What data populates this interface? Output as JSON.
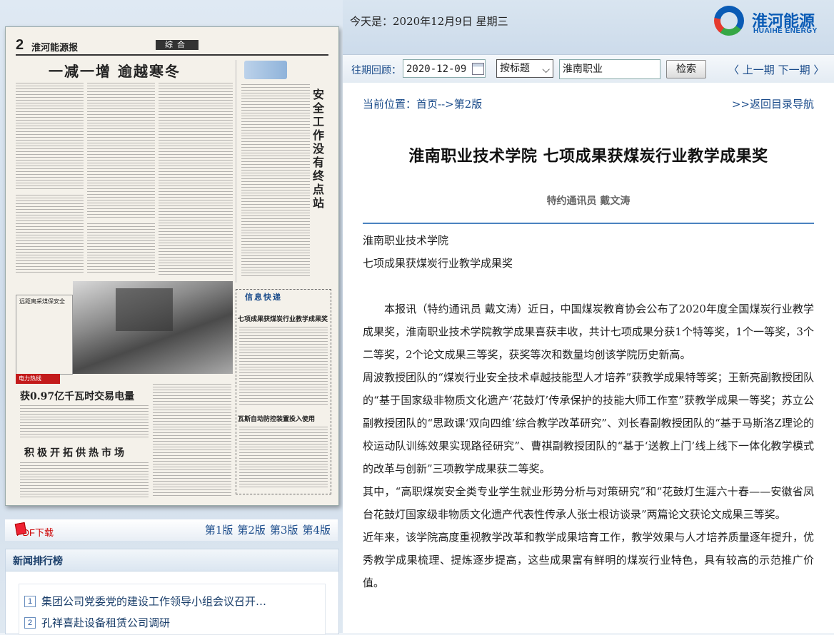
{
  "header": {
    "date_text": "今天是：2020年12月9日  星期三",
    "logo": {
      "cn": "淮河能源",
      "en": "HUAIHE ENERGY",
      "colors": [
        "#0a5bb5",
        "#36a745",
        "#e53a2e"
      ]
    }
  },
  "search": {
    "label": "往期回顾：",
    "date_value": "2020-12-09",
    "mode_selected": "按标题",
    "keyword_value": "淮南职业",
    "submit_label": "检索",
    "prev_label": "〈 上一期",
    "next_label": "下一期 〉"
  },
  "breadcrumb": {
    "text": "当前位置：首页-->第2版",
    "back_label": ">>返回目录导航"
  },
  "article": {
    "title": "淮南职业技术学院  七项成果获煤炭行业教学成果奖",
    "author": "特约通讯员  戴文涛",
    "lead1": "淮南职业技术学院",
    "lead2": "七项成果获煤炭行业教学成果奖",
    "p1": "本报讯（特约通讯员 戴文涛）近日，中国煤炭教育协会公布了2020年度全国煤炭行业教学成果奖，淮南职业技术学院教学成果喜获丰收，共计七项成果分获1个特等奖，1个一等奖，3个二等奖，2个论文成果三等奖，获奖等次和数量均创该学院历史新高。",
    "p2": "周波教授团队的“煤炭行业安全技术卓越技能型人才培养”获教学成果特等奖；王新亮副教授团队的“基于国家级非物质文化遗产‘花鼓灯’传承保护的技能大师工作室”获教学成果一等奖；苏立公副教授团队的“思政课‘双向四维’综合教学改革研究”、刘长春副教授团队的“基于马斯洛Z理论的校运动队训练效果实现路径研究”、曹祺副教授团队的“基于‘送教上门’线上线下一体化教学模式的改革与创新”三项教学成果获二等奖。",
    "p3": "其中，“高职煤炭安全类专业学生就业形势分析与对策研究”和“花鼓灯生涯六十春——安徽省凤台花鼓灯国家级非物质文化遗产代表性传承人张士根访谈录”两篇论文获论文成果三等奖。",
    "p4": "近年来，该学院高度重视教学改革和教学成果培育工作，教学效果与人才培养质量逐年提升，优秀教学成果梳理、提炼逐步提高，这些成果富有鲜明的煤炭行业特色，具有较高的示范推广价值。"
  },
  "newspaper": {
    "page_no": "2",
    "masthead": "淮河能源报",
    "section": "综合",
    "headline": "一减一增  逾越寒冬",
    "safety_vertical": "安全工作没有终点站",
    "info_title": "信息快递",
    "info_item1": "七项成果获煤炭行业教学成果奖",
    "info_item2": "瓦斯自动防控装置投入使用",
    "left_box": "远距离采煤保安全",
    "ad_badge": "电力热线",
    "headline2": "获0.97亿千瓦时交易电量",
    "headline3": "积极开拓供热市场"
  },
  "page_nav": {
    "pdf_label": "PDF下载",
    "pages": [
      "第1版",
      "第2版",
      "第3版",
      "第4版"
    ]
  },
  "ranking": {
    "title": "新闻排行榜",
    "items": [
      {
        "num": "1",
        "text": "集团公司党委党的建设工作领导小组会议召开…"
      },
      {
        "num": "2",
        "text": "孔祥喜赴设备租赁公司调研"
      }
    ]
  }
}
